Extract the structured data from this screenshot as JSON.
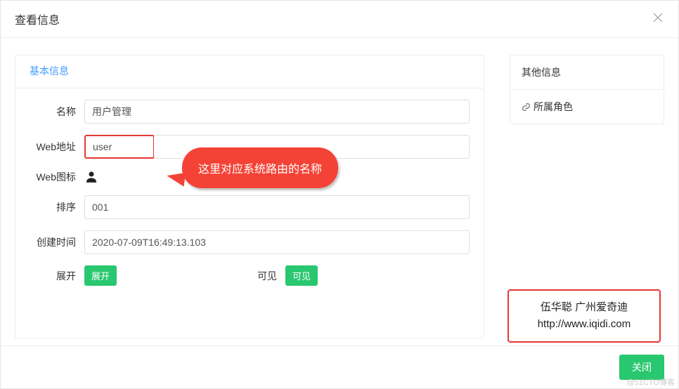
{
  "modal": {
    "title": "查看信息",
    "close_button": "关闭"
  },
  "tabs": {
    "basic": "基本信息"
  },
  "form": {
    "name_label": "名称",
    "name_value": "用户管理",
    "url_label": "Web地址",
    "url_value": "user",
    "icon_label": "Web图标",
    "sort_label": "排序",
    "sort_value": "001",
    "create_label": "创建时间",
    "create_value": "2020-07-09T16:49:13.103",
    "expand_label": "展开",
    "expand_tag": "展开",
    "visible_label": "可见",
    "visible_tag": "可见"
  },
  "side": {
    "other_info": "其他信息",
    "roles": "所属角色"
  },
  "callout": {
    "text": "这里对应系统路由的名称"
  },
  "info_box": {
    "line1": "伍华聪 广州爱奇迪",
    "line2": "http://www.iqidi.com"
  },
  "watermark": "@51CTO博客"
}
